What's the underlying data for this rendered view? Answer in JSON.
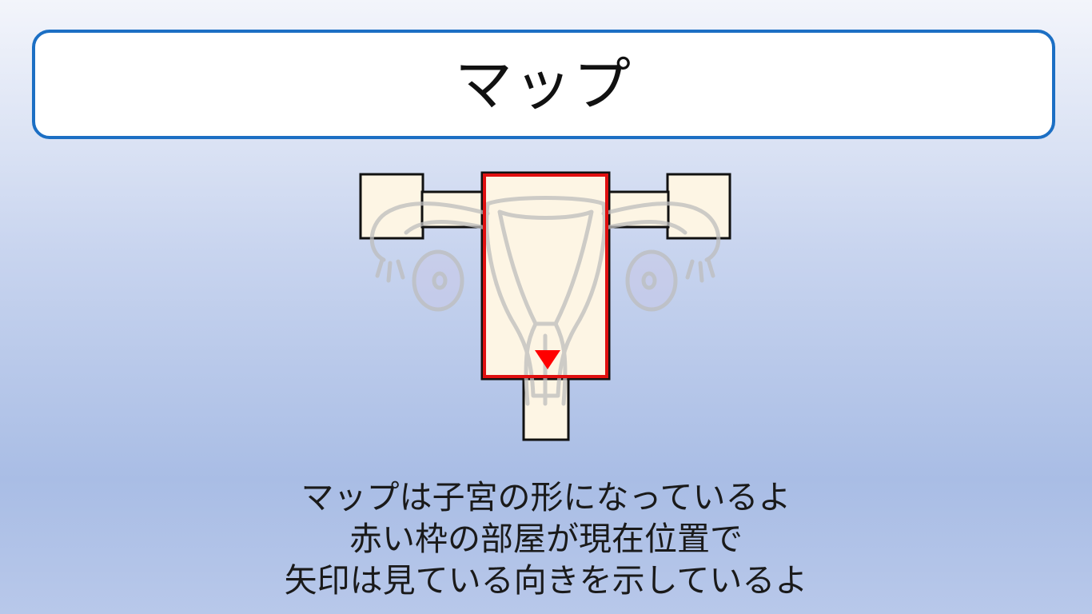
{
  "header": {
    "title": "マップ"
  },
  "map": {
    "rooms": [
      {
        "id": "left-ovary-room",
        "current": false
      },
      {
        "id": "left-corridor",
        "current": false
      },
      {
        "id": "uterus-room",
        "current": true
      },
      {
        "id": "right-corridor",
        "current": false
      },
      {
        "id": "right-ovary-room",
        "current": false
      },
      {
        "id": "bottom-corridor",
        "current": false
      }
    ],
    "player_direction": "down",
    "colors": {
      "room_fill": "#fdf5e4",
      "room_stroke": "#111111",
      "current_room_stroke": "#e01010",
      "player_marker": "#ff0000",
      "uterus_outline": "#bdbdbd",
      "ovary_fill": "#c8c4e6"
    },
    "background_icon": "uterus-illustration-icon"
  },
  "caption": {
    "line1": "マップは子宮の形になっているよ",
    "line2": "赤い枠の部屋が現在位置で",
    "line3": "矢印は見ている向きを示しているよ"
  },
  "theme": {
    "accent": "#1c6fc4"
  }
}
